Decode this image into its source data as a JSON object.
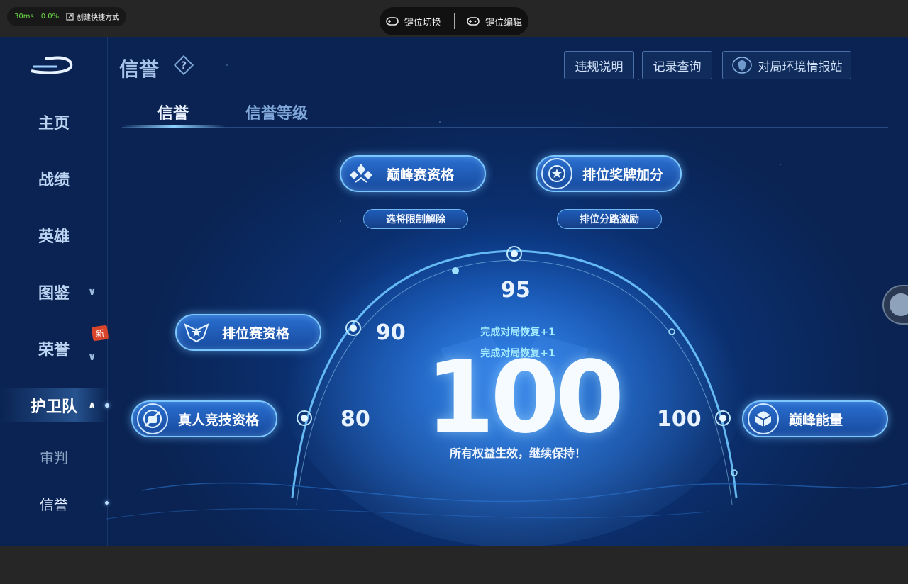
{
  "perf": {
    "ping": "30ms",
    "loss": "0.0%",
    "shortcut": "创建快捷方式"
  },
  "keybar": {
    "switch": "键位切换",
    "edit": "键位编辑"
  },
  "sidebar": {
    "items": [
      {
        "label": "主页"
      },
      {
        "label": "战绩"
      },
      {
        "label": "英雄"
      },
      {
        "label": "图鉴"
      },
      {
        "label": "荣誉"
      },
      {
        "label": "护卫队"
      }
    ],
    "new_badge": "新",
    "sub_items": [
      {
        "label": "审判"
      },
      {
        "label": "信誉"
      }
    ]
  },
  "header": {
    "title": "信誉",
    "buttons": {
      "rules": "违规说明",
      "records": "记录查询",
      "report": "对局环境情报站"
    }
  },
  "tabs": [
    {
      "label": "信誉"
    },
    {
      "label": "信誉等级"
    }
  ],
  "perks": {
    "peak": "巅峰赛资格",
    "medal": "排位奖牌加分",
    "ranked": "排位赛资格",
    "human": "真人竞技资格",
    "energy": "巅峰能量"
  },
  "pills": {
    "hero_pick": "选将限制解除",
    "lane": "排位分路激励"
  },
  "thresholds": {
    "t95": "95",
    "t90": "90",
    "t80": "80",
    "t100": "100"
  },
  "score": {
    "value": "100",
    "recover_1": "完成对局恢复+1",
    "recover_2": "完成对局恢复+1",
    "status": "所有权益生效，继续保持！"
  },
  "colors": {
    "accent": "#7cc7ff",
    "panel": "#174a9e",
    "bg": "#0a2352"
  }
}
